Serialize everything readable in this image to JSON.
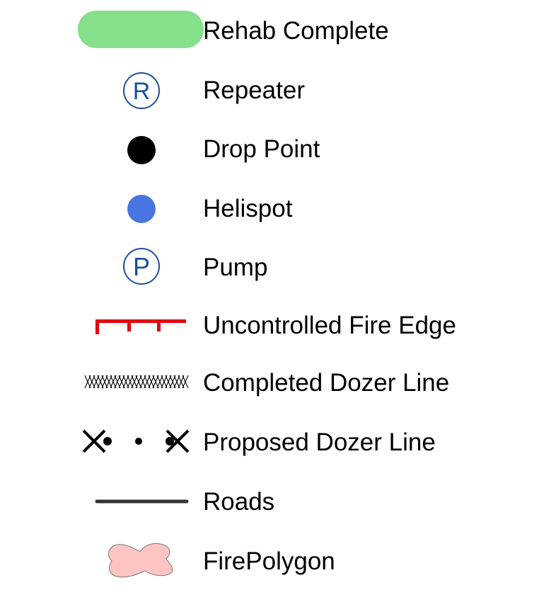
{
  "legend": {
    "items": [
      {
        "label": "Rehab Complete",
        "icon": "rehab-complete-swatch",
        "color": "#86DF8B"
      },
      {
        "label": "Repeater",
        "icon": "repeater-icon",
        "color": "#1E4F9C"
      },
      {
        "label": "Drop Point",
        "icon": "drop-point-icon",
        "color": "#000000"
      },
      {
        "label": "Helispot",
        "icon": "helispot-icon",
        "color": "#4A74E0"
      },
      {
        "label": "Pump",
        "icon": "pump-icon",
        "color": "#1E4F9C"
      },
      {
        "label": "Uncontrolled Fire Edge",
        "icon": "uncontrolled-fire-edge-symbol",
        "color": "#E3000F"
      },
      {
        "label": "Completed Dozer Line",
        "icon": "completed-dozer-line-symbol",
        "color": "#000000"
      },
      {
        "label": "Proposed Dozer Line",
        "icon": "proposed-dozer-line-symbol",
        "color": "#000000"
      },
      {
        "label": "Roads",
        "icon": "roads-line-symbol",
        "color": "#333333"
      },
      {
        "label": "FirePolygon",
        "icon": "fire-polygon-swatch",
        "color": "#FFC4C4"
      }
    ],
    "repeater_glyph": "R",
    "pump_glyph": "P"
  }
}
